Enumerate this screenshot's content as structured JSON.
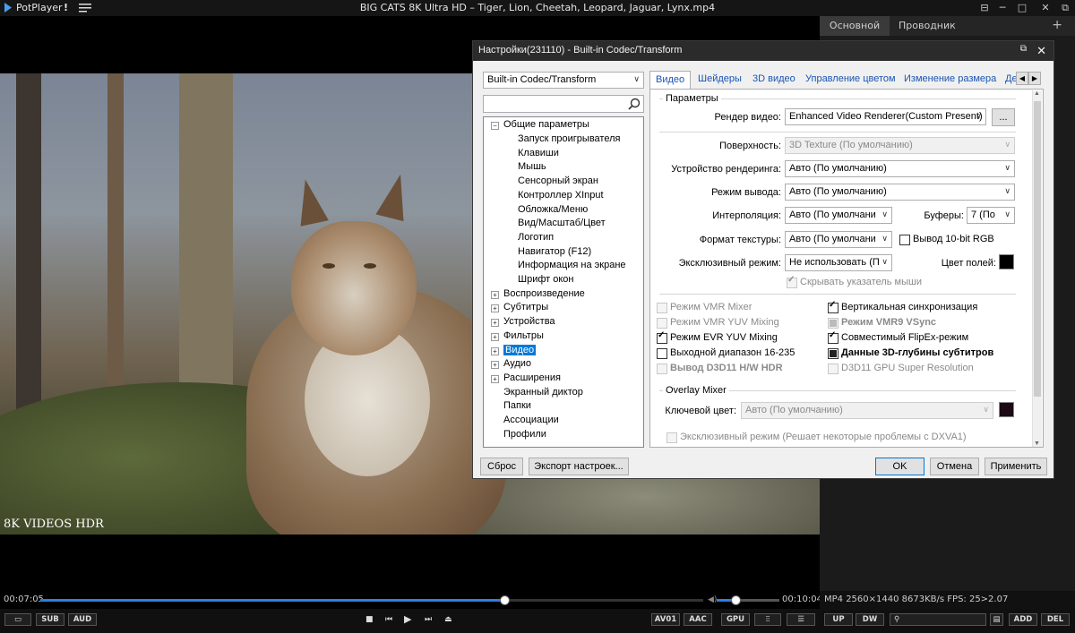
{
  "titlebar": {
    "app_name": "PotPlayer",
    "pin": "!",
    "title": "BIG CATS 8K Ultra HD – Tiger, Lion, Cheetah, Leopard, Jaguar, Lynx.mp4"
  },
  "video": {
    "watermark": "8K VIDEOS HDR"
  },
  "right_panel": {
    "tabs": [
      "Основной",
      "Проводник"
    ],
    "add": "+"
  },
  "seekbar": {
    "elapsed": "00:07:05",
    "total": "00:10:04",
    "progress": 0.7,
    "volume": 0.3
  },
  "info": {
    "text": "MP4  2560×1440  8673KB/s  FPS: 25>2.07"
  },
  "controls": {
    "left": [
      "SUB",
      "AUD"
    ],
    "right": [
      "AV01",
      "AAC",
      "GPU"
    ],
    "panel": [
      "UP",
      "DW",
      "ADD",
      "DEL"
    ]
  },
  "dialog": {
    "title": "Настройки(231110) - Built-in Codec/Transform",
    "category_select": "Built-in Codec/Transform",
    "tree": {
      "general": "Общие параметры",
      "general_children": [
        "Запуск проигрывателя",
        "Клавиши",
        "Мышь",
        "Сенсорный экран",
        "Контроллер XInput",
        "Обложка/Меню",
        "Вид/Масштаб/Цвет",
        "Логотип",
        "Навигатор (F12)",
        "Информация на экране",
        "Шрифт окон"
      ],
      "groups": [
        "Воспроизведение",
        "Субтитры",
        "Устройства",
        "Фильтры",
        "Видео",
        "Аудио",
        "Расширения"
      ],
      "leaves": [
        "Экранный диктор",
        "Папки",
        "Ассоциации",
        "Профили"
      ]
    },
    "tabs": [
      "Видео",
      "Шейдеры",
      "3D видео",
      "Управление цветом",
      "Изменение размера",
      "Де"
    ],
    "params_group": "Параметры",
    "video_renderer_label": "Рендер видео:",
    "video_renderer": "Enhanced Video Renderer(Custom Present)",
    "more_button": "...",
    "surface_label": "Поверхность:",
    "surface": "3D Texture (По умолчанию)",
    "render_device_label": "Устройство рендеринга:",
    "render_device": "Авто (По умолчанию)",
    "output_mode_label": "Режим вывода:",
    "output_mode": "Авто (По умолчанию)",
    "interpolation_label": "Интерполяция:",
    "interpolation": "Авто (По умолчани",
    "buffers_label": "Буферы:",
    "buffers": "7 (По",
    "texture_format_label": "Формат текстуры:",
    "texture_format": "Авто (По умолчани",
    "output_10bit": "Вывод 10-bit RGB",
    "exclusive_mode_label": "Эксклюзивный режим:",
    "exclusive_mode": "Не использовать (П",
    "field_color_label": "Цвет полей:",
    "hide_pointer": "Скрывать указатель мыши",
    "checks_left": [
      "Режим VMR Mixer",
      "Режим VMR YUV Mixing",
      "Режим EVR YUV Mixing",
      "Выходной диапазон 16-235",
      "Вывод D3D11 H/W HDR"
    ],
    "checks_right": [
      "Вертикальная синхронизация",
      "Режим VMR9 VSync",
      "Совместимый FlipEx-режим",
      "Данные 3D-глубины субтитров",
      "D3D11 GPU Super Resolution"
    ],
    "overlay_group": "Overlay Mixer",
    "key_color_label": "Ключевой цвет:",
    "key_color": "Авто (По умолчанию)",
    "overlay_exclusive": "Эксклюзивный режим (Решает некоторые проблемы с DXVA1)",
    "reset_button": "Сброс",
    "export_button": "Экспорт настроек...",
    "ok_button": "OK",
    "cancel_button": "Отмена",
    "apply_button": "Применить"
  }
}
